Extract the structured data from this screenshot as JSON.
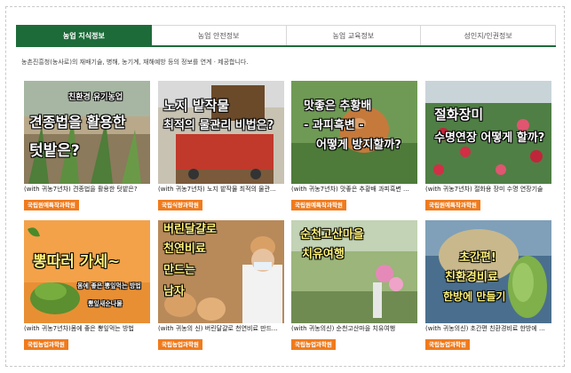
{
  "tabs": [
    {
      "label": "농업 지식정보",
      "active": true
    },
    {
      "label": "농업 안전정보",
      "active": false
    },
    {
      "label": "농업 교육정보",
      "active": false
    },
    {
      "label": "성인지/인권정보",
      "active": false
    }
  ],
  "description": "농촌진흥청(농사로)의 재배기술, 병해, 농기계, 재해예방 등의 정보를 연계 · 제공합니다.",
  "colors": {
    "accent": "#1e6b3a",
    "badge": "#f07b1d"
  },
  "cards": [
    {
      "overlay": [
        "친환경 유기농업",
        "견종법을 활용한",
        "텃밭은?"
      ],
      "caption": "(with 귀농7년차) 견종법을 활용한 텃밭은?",
      "badge": "국립원예특작과학원"
    },
    {
      "overlay": [
        "노지 밭작물",
        "최적의 물관리 비법은?"
      ],
      "caption": "(with 귀농7년차) 노지 밭작물 최적의 물관...",
      "badge": "국립식량과학원"
    },
    {
      "overlay": [
        "맛좋은 추황배",
        "- 과피흑변 -",
        "어떻게 방지할까?"
      ],
      "caption": "(with 귀농7년차) 맛좋은 추황배 과피흑변 ...",
      "badge": "국립원예특작과학원"
    },
    {
      "overlay": [
        "절화장미",
        "수명연장 어떻게 할까?"
      ],
      "caption": "(with 귀농7년차) 절화용 장미 수명 연장기술",
      "badge": "국립원예특작과학원"
    },
    {
      "overlay": [
        "뽕따러 가세~",
        "몸에 좋은 뽕잎먹는 방법",
        "뽕잎새순나물"
      ],
      "caption": "(with 귀농7년차)몸에 좋은 뽕잎먹는 방법",
      "badge": "국립농업과학원"
    },
    {
      "overlay": [
        "버린달걀로",
        "천연비료",
        "만드는",
        "남자"
      ],
      "caption": "(with 귀농의 신) 버린달걀로 천연비료 만드...",
      "badge": "국립농업과학원"
    },
    {
      "overlay": [
        "순천고산마을",
        "치유여행"
      ],
      "caption": "(with 귀농의신) 순천고산마을 치유여행",
      "badge": "국립농업과학원"
    },
    {
      "overlay": [
        "초간편!",
        "친환경비료",
        "한방에 만들기"
      ],
      "caption": "(with 귀농의신) 초간편 친환경비료 한방에 ...",
      "badge": "국립농업과학원"
    }
  ]
}
